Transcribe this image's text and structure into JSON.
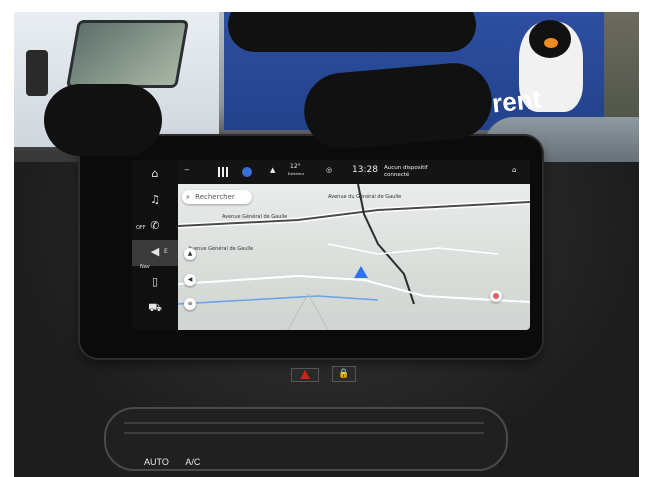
{
  "sign": {
    "brand_text": "rent"
  },
  "screen": {
    "sidebar": [
      {
        "icon": "home-icon",
        "glyph": "⌂"
      },
      {
        "icon": "music-icon",
        "glyph": "♫"
      },
      {
        "icon": "phone-icon",
        "glyph": "✆",
        "badge": "OFF"
      },
      {
        "icon": "nav-icon",
        "glyph": "◀",
        "label": "Nav",
        "suffix": "E",
        "active": true
      },
      {
        "icon": "mobile-icon",
        "glyph": "▯"
      },
      {
        "icon": "car-icon",
        "glyph": "⛟"
      }
    ],
    "topbar": {
      "temperature": "12°",
      "temperature_sub": "Exterieur",
      "time": "13:28",
      "status": "Aucun dispositif connecté"
    },
    "map": {
      "search_placeholder": "Rechercher",
      "roads": [
        "Avenue du Général de Gaulle",
        "Avenue Général de Gaulle",
        "Avenue Général de Gaulle"
      ]
    }
  },
  "dashboard": {
    "climate": [
      "AUTO",
      "A/C"
    ]
  },
  "colors": {
    "accent": "#2f74e6",
    "sign_blue": "#2e4fa0",
    "redaction": "#111111"
  }
}
